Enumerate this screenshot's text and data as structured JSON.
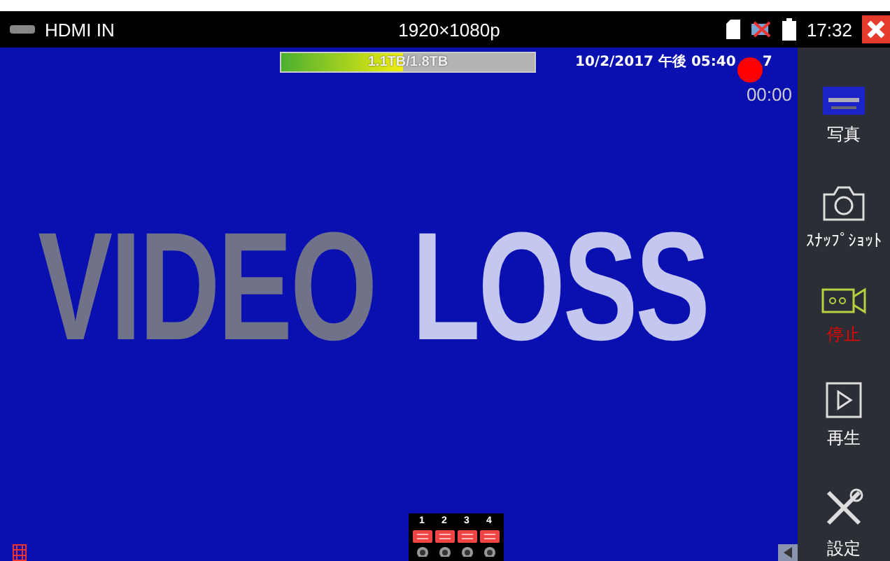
{
  "status_bar": {
    "source": "HDMI IN",
    "resolution": "1920×1080p",
    "time": "17:32"
  },
  "overlay": {
    "storage": {
      "text": "1.1TB/1.8TB",
      "level": 0.48
    },
    "timestamp": "10/2/2017 午後 05:40",
    "timestamp_tail": "7",
    "recording": true,
    "timer": "00:00"
  },
  "message": {
    "first": "VIDEO",
    "second": "LOSS"
  },
  "channels": [
    {
      "label": "1"
    },
    {
      "label": "2"
    },
    {
      "label": "3"
    },
    {
      "label": "4"
    }
  ],
  "sidebar": {
    "items": [
      {
        "label": "写真",
        "active": false
      },
      {
        "kind": "snapshot",
        "label": "ｽﾅｯﾌﾟｼｮｯﾄ",
        "active": false
      },
      {
        "kind": "record",
        "label": "停止",
        "active": true
      },
      {
        "kind": "playback",
        "label": "再生",
        "active": false
      },
      {
        "kind": "settings",
        "label": "設定",
        "active": false
      }
    ]
  }
}
